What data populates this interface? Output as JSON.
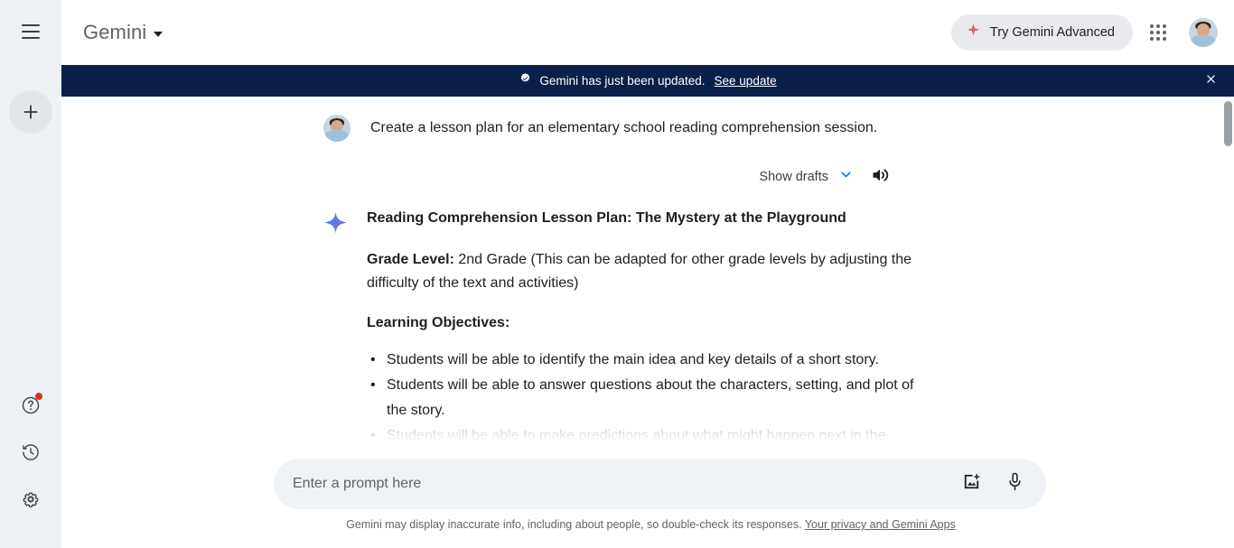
{
  "sidebar": {
    "menu_icon": "hamburger-menu-icon",
    "new_chat_icon": "plus-icon",
    "items": [
      {
        "icon": "help-question-icon",
        "name": "help",
        "has_notification": true
      },
      {
        "icon": "history-clock-icon",
        "name": "activity-history",
        "has_notification": false
      },
      {
        "icon": "settings-gear-icon",
        "name": "settings",
        "has_notification": false
      }
    ],
    "background_color": "#eef1f6"
  },
  "topbar": {
    "brand_name": "Gemini",
    "brand_caret_icon": "caret-down-icon",
    "advanced_pill": {
      "label": "Try Gemini Advanced",
      "icon": "sparkle-icon",
      "icon_color": "#e05b73",
      "background_color": "#e9eaee"
    },
    "apps_grid_icon": "google-apps-grid-icon",
    "avatar_icon": "user-avatar"
  },
  "banner": {
    "icon": "verified-badge-check-icon",
    "text": "Gemini has just been updated.",
    "link_label": "See update",
    "close_icon": "close-x-icon",
    "background_color": "#0b1f4b",
    "text_color": "#ffffff"
  },
  "conversation": {
    "user_message": {
      "avatar_icon": "user-avatar",
      "text": "Create a lesson plan for an elementary school reading comprehension session."
    },
    "drafts": {
      "label": "Show drafts",
      "caret_icon": "chevron-down-icon",
      "caret_color": "#1a73e8",
      "speaker_icon": "volume-speaker-icon"
    },
    "response": {
      "avatar_icon": "gemini-sparkle-icon",
      "title": "Reading Comprehension Lesson Plan: The Mystery at the Playground",
      "grade_label": "Grade Level:",
      "grade_value": " 2nd Grade (This can be adapted for other grade levels by adjusting the difficulty of the text and activities)",
      "objectives_heading": "Learning Objectives:",
      "objectives": [
        "Students will be able to identify the main idea and key details of a short story.",
        "Students will be able to answer questions about the characters, setting, and plot of the story.",
        "Students will be able to make predictions about what might happen next in the"
      ]
    }
  },
  "scrollbar": {
    "name": "vertical-scrollbar",
    "thumb_color": "#9aa0a6"
  },
  "composer": {
    "placeholder": "Enter a prompt here",
    "value": "",
    "add_image_icon": "add-image-icon",
    "mic_icon": "microphone-icon",
    "background_color": "#eff2f7"
  },
  "footer": {
    "disclaimer": "Gemini may display inaccurate info, including about people, so double-check its responses.",
    "link_label": "Your privacy and Gemini Apps"
  }
}
